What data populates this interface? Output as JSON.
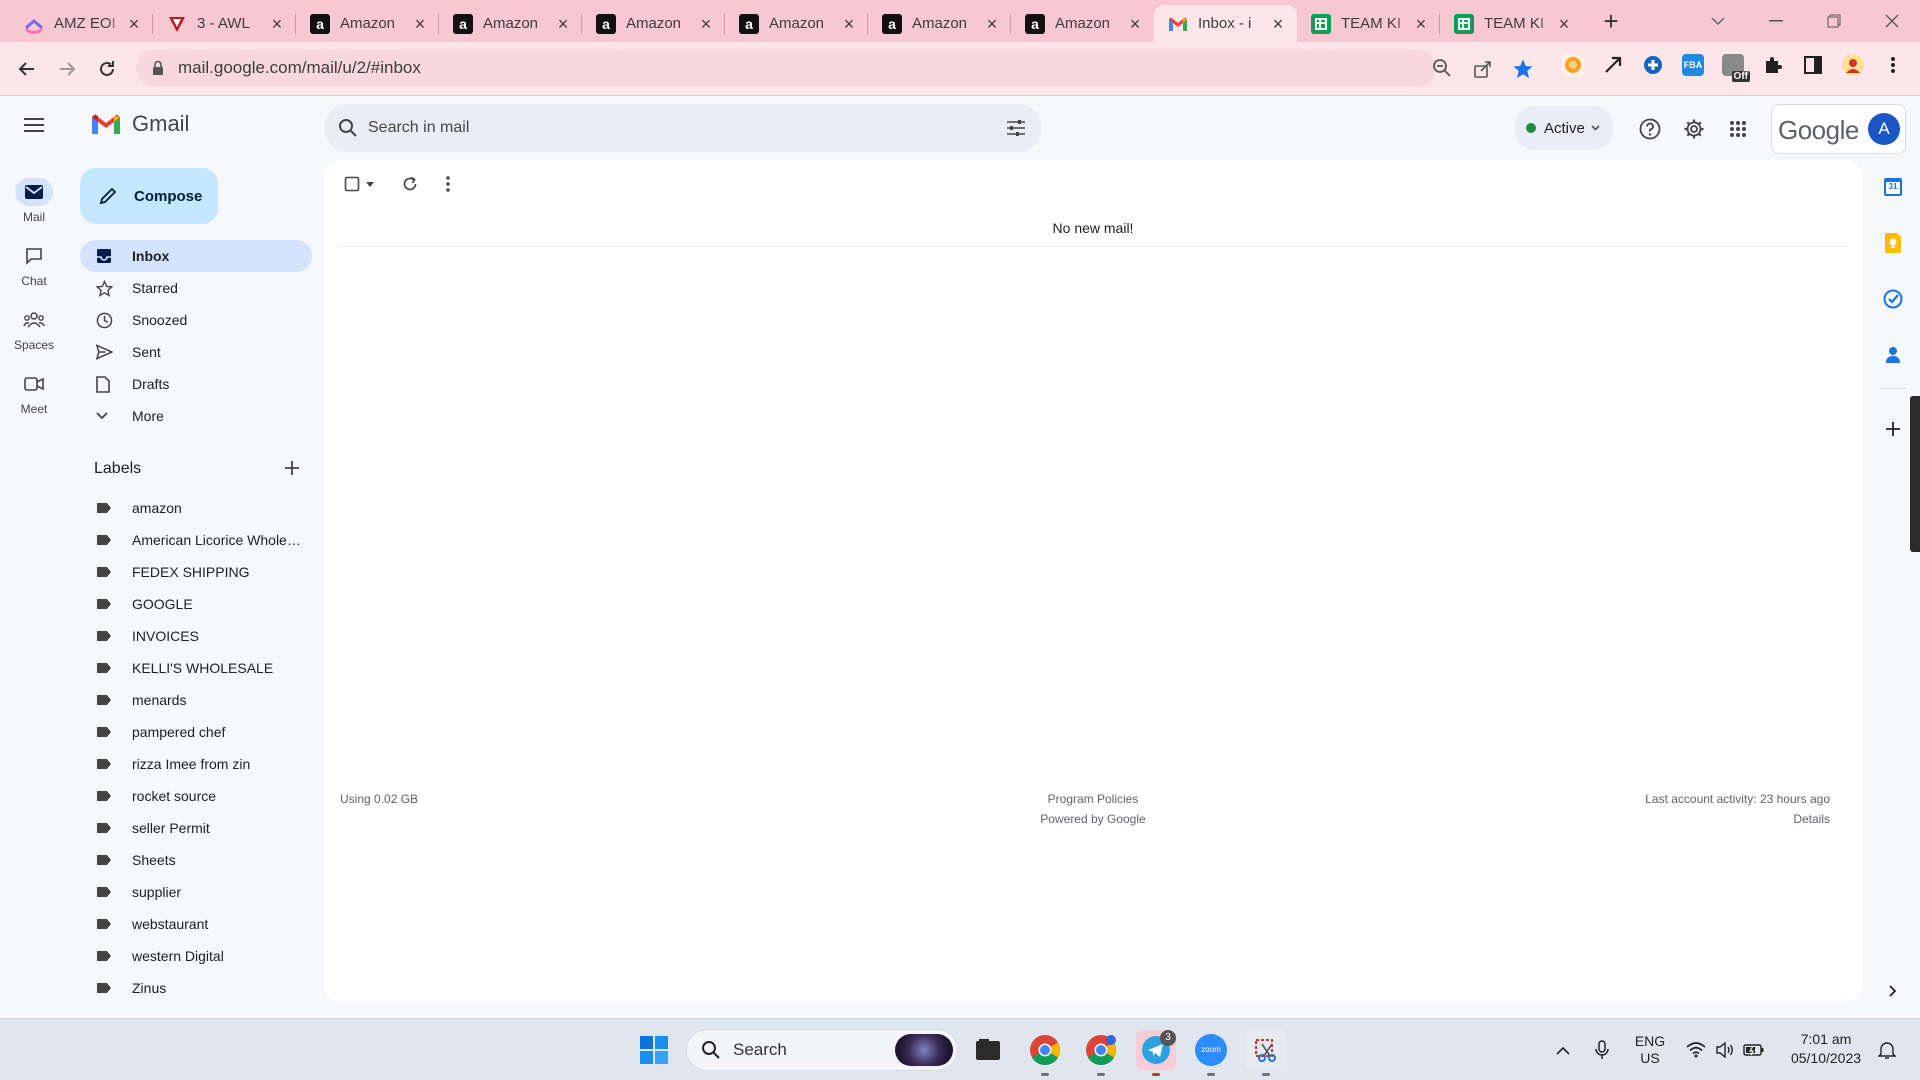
{
  "browser": {
    "tabs": [
      {
        "title": "AMZ EOI",
        "icon": "clickup-icon"
      },
      {
        "title": "3 - AWL",
        "icon": "vivaldi-icon"
      },
      {
        "title": "Amazon",
        "icon": "amazon-icon"
      },
      {
        "title": "Amazon",
        "icon": "amazon-icon"
      },
      {
        "title": "Amazon",
        "icon": "amazon-icon"
      },
      {
        "title": "Amazon",
        "icon": "amazon-icon"
      },
      {
        "title": "Amazon",
        "icon": "amazon-icon"
      },
      {
        "title": "Amazon",
        "icon": "amazon-icon"
      },
      {
        "title": "Inbox - i",
        "icon": "gmail-icon",
        "active": true
      },
      {
        "title": "TEAM KI",
        "icon": "sheets-icon"
      },
      {
        "title": "TEAM KI",
        "icon": "sheets-icon"
      }
    ],
    "url": "mail.google.com/mail/u/2/#inbox",
    "extension_badge": "Off"
  },
  "gmail": {
    "app_name": "Gmail",
    "rail": [
      {
        "label": "Mail",
        "icon": "mail-icon"
      },
      {
        "label": "Chat",
        "icon": "chat-icon"
      },
      {
        "label": "Spaces",
        "icon": "spaces-icon"
      },
      {
        "label": "Meet",
        "icon": "meet-icon"
      }
    ],
    "compose_label": "Compose",
    "nav": [
      {
        "label": "Inbox",
        "icon": "inbox-icon"
      },
      {
        "label": "Starred",
        "icon": "star-icon"
      },
      {
        "label": "Snoozed",
        "icon": "clock-icon"
      },
      {
        "label": "Sent",
        "icon": "send-icon"
      },
      {
        "label": "Drafts",
        "icon": "draft-icon"
      },
      {
        "label": "More",
        "icon": "chevron-down-icon"
      }
    ],
    "labels_title": "Labels",
    "labels": [
      "amazon",
      "American Licorice Wholesale",
      "FEDEX SHIPPING",
      "GOOGLE",
      "INVOICES",
      "KELLI'S WHOLESALE",
      "menards",
      "pampered chef",
      "rizza Imee from zin",
      "rocket source",
      "seller Permit",
      "Sheets",
      "supplier",
      "webstaurant",
      "western Digital",
      "Zinus"
    ],
    "search_placeholder": "Search in mail",
    "status": "Active",
    "google_wordmark": "Google",
    "avatar_letter": "A",
    "empty_message": "No new mail!",
    "footer": {
      "storage": "Using 0.02 GB",
      "policies": "Program Policies",
      "powered": "Powered by Google",
      "activity": "Last account activity: 23 hours ago",
      "details": "Details"
    },
    "side_panel_calendar_day": "31"
  },
  "taskbar": {
    "search_label": "Search",
    "telegram_badge": "3",
    "zoom_label": "zoom",
    "lang_primary": "ENG",
    "lang_secondary": "US",
    "time": "7:01 am",
    "date": "05/10/2023"
  },
  "colors": {
    "tabbar": "#f8c8d2",
    "toolbar": "#fde6ea",
    "compose": "#c2e7ff",
    "selected_nav": "#d3e3fd",
    "active_status": "#1e8e3e"
  }
}
